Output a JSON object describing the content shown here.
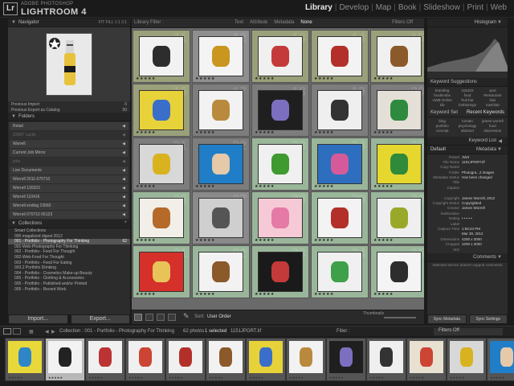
{
  "app": {
    "brand_small": "ADOBE PHOTOSHOP",
    "brand_big": "LIGHTROOM 4",
    "logo": "Lr",
    "modules": [
      "Library",
      "Develop",
      "Map",
      "Book",
      "Slideshow",
      "Print",
      "Web"
    ],
    "active_module": "Library"
  },
  "left": {
    "navigator": {
      "title": "Navigator",
      "zoom": [
        "FIT",
        "FILL",
        "1:1",
        "3:1"
      ]
    },
    "previous": [
      {
        "label": "Previous Import",
        "count": "0"
      },
      {
        "label": "Previous Export as Catalog",
        "count": "50"
      }
    ],
    "folders_title": "Folders",
    "folders": [
      {
        "label": "Retail",
        "count": "",
        "dim": false
      },
      {
        "label": "Z3957 Lacity",
        "count": "",
        "dim": true
      },
      {
        "label": "Warrell",
        "count": "",
        "dim": false
      },
      {
        "label": "Current Job Mirror",
        "count": "",
        "dim": false
      },
      {
        "label": "jobs",
        "count": "",
        "dim": true
      },
      {
        "label": "Live Documents",
        "count": "",
        "dim": false
      },
      {
        "label": "Worrell 2011-070710",
        "count": "",
        "dim": false
      },
      {
        "label": "Worrell 130323",
        "count": "",
        "dim": false
      },
      {
        "label": "Worrell 110416",
        "count": "",
        "dim": false
      },
      {
        "label": "Worrell ending 23560",
        "count": "",
        "dim": false
      },
      {
        "label": "Worrell 070710 05123",
        "count": "",
        "dim": false
      }
    ],
    "collections_title": "Collections",
    "collections": [
      {
        "label": "Smart Collections",
        "count": "",
        "sel": false
      },
      {
        "label": "000 magalized digest 2012",
        "count": "",
        "sel": false
      },
      {
        "label": "001 - Portfolio - Photography For Thinking",
        "count": "62",
        "sel": true
      },
      {
        "label": "001-Web-Photography For Thinking",
        "count": "",
        "sel": false
      },
      {
        "label": "002 - Portfolio - Food For Thought",
        "count": "",
        "sel": false
      },
      {
        "label": "002-Web-Food For Thought",
        "count": "",
        "sel": false
      },
      {
        "label": "003 - Portfolio - Food For Eating",
        "count": "",
        "sel": false
      },
      {
        "label": "003.2 Portfolio Drinking",
        "count": "",
        "sel": false
      },
      {
        "label": "004 - Portfolio - Cosmetics Make-up Beauty",
        "count": "",
        "sel": false
      },
      {
        "label": "005 - Portfolio - Clothing & Accessories",
        "count": "",
        "sel": false
      },
      {
        "label": "005 - Portfolio - Published and/or Printed",
        "count": "",
        "sel": false
      },
      {
        "label": "005 - Portfolio - Recent Work",
        "count": "",
        "sel": false
      }
    ],
    "import_label": "Import...",
    "export_label": "Export..."
  },
  "filter": {
    "title": "Library Filter :",
    "options": [
      "Text",
      "Attribute",
      "Metadata",
      "None"
    ],
    "active": "None",
    "preset": "Filters Off"
  },
  "grid_cells": [
    {
      "n": "11",
      "bg": "#9aa07a",
      "thumb": "#f2f2f2",
      "accent": "#2d2d2d"
    },
    {
      "n": "12",
      "bg": "#8f8f8f",
      "thumb": "#f4f4f4",
      "accent": "#c9961f"
    },
    {
      "n": "13",
      "bg": "#9aa07a",
      "thumb": "#f0f0f0",
      "accent": "#c43a3a"
    },
    {
      "n": "14",
      "bg": "#9aa07a",
      "thumb": "#f3f3f3",
      "accent": "#b3302a"
    },
    {
      "n": "15",
      "bg": "#9aa07a",
      "thumb": "#f0f0f0",
      "accent": "#8c5a2a"
    },
    {
      "n": "16",
      "bg": "#9aa07a",
      "thumb": "#e8d23a",
      "accent": "#3a6fc9"
    },
    {
      "n": "17",
      "bg": "#7d7d7d",
      "thumb": "#f2f2f2",
      "accent": "#b98a3e"
    },
    {
      "n": "18",
      "bg": "#7d7d7d",
      "thumb": "#1f1f1f",
      "accent": "#7d6fbf"
    },
    {
      "n": "19",
      "bg": "#7d7d7d",
      "thumb": "#efefef",
      "accent": "#333"
    },
    {
      "n": "20",
      "bg": "#7d7d7d",
      "thumb": "#e4e0d8",
      "accent": "#2e8a3e"
    },
    {
      "n": "21",
      "bg": "#7d7d7d",
      "thumb": "#d8d8d8",
      "accent": "#d8b31f"
    },
    {
      "n": "22",
      "bg": "#7d7d7d",
      "thumb": "#1f7ec7",
      "accent": "#e5c9a8"
    },
    {
      "n": "23",
      "bg": "#9ab69a",
      "thumb": "#f0f0f0",
      "accent": "#3f9a2f"
    },
    {
      "n": "24",
      "bg": "#9ab69a",
      "thumb": "#2d6fbe",
      "accent": "#d55a9a"
    },
    {
      "n": "25",
      "bg": "#9ab69a",
      "thumb": "#e6d72e",
      "accent": "#2f8a3a"
    },
    {
      "n": "26",
      "bg": "#9ab69a",
      "thumb": "#f2efe8",
      "accent": "#b56a2a"
    },
    {
      "n": "27",
      "bg": "#8a8a8a",
      "thumb": "#cfcfcf",
      "accent": "#555"
    },
    {
      "n": "28",
      "bg": "#9ab69a",
      "thumb": "#f6c9d6",
      "accent": "#e47aa5"
    },
    {
      "n": "29",
      "bg": "#9ab69a",
      "thumb": "#f3f3f3",
      "accent": "#b3302a"
    },
    {
      "n": "30",
      "bg": "#9ab69a",
      "thumb": "#efefef",
      "accent": "#9aa82a"
    },
    {
      "n": "31",
      "bg": "#9ab69a",
      "thumb": "#d6302a",
      "accent": "#e8c35a"
    },
    {
      "n": "32",
      "bg": "#9ab69a",
      "thumb": "#f2f2f2",
      "accent": "#8a5a2a"
    },
    {
      "n": "33",
      "bg": "#9ab69a",
      "thumb": "#1a1a1a",
      "accent": "#c43a3a"
    },
    {
      "n": "34",
      "bg": "#9ab69a",
      "thumb": "#f0f0f0",
      "accent": "#3fa04a"
    },
    {
      "n": "35",
      "bg": "#9ab69a",
      "thumb": "#f4f4f4",
      "accent": "#2d2d2d"
    }
  ],
  "toolbar": {
    "sort_label": "Sort:",
    "sort_value": "User Order",
    "thumbs_label": "Thumbnails"
  },
  "right": {
    "histogram_title": "Histogram",
    "kw_suggest_title": "Keyword Suggestions",
    "kw_suggest": [
      "branding",
      "1184Z2",
      "spot",
      "foodsnobs",
      "food",
      "Restaurant",
      "AWB Online",
      "fruit bar",
      "kiwi",
      "kib",
      "forthdesign",
      "mashlab"
    ],
    "kw_set_title": "Keyword Set",
    "kw_set_value": "Recent Keywords",
    "kw_set": [
      "blog",
      "tomato",
      "james worrell",
      "portfolio",
      "psychology",
      "food",
      "concept",
      "abstract",
      "depression"
    ],
    "kw_list_title": "Keyword List",
    "metadata_title": "Metadata",
    "metadata_preset": "Default",
    "meta": [
      {
        "k": "Preset",
        "v": "JWII"
      },
      {
        "k": "File Name",
        "v": "1151JPORT.tif"
      },
      {
        "k": "Copy Name",
        "v": ""
      },
      {
        "k": "Folder",
        "v": "Photogra...2 images"
      },
      {
        "k": "Metadata Status",
        "v": "Has been changed"
      },
      {
        "k": "Title",
        "v": ""
      },
      {
        "k": "Caption",
        "v": ""
      },
      {
        "k": "",
        "v": ""
      },
      {
        "k": "Copyright",
        "v": "James Worrell, 2012"
      },
      {
        "k": "Copyright Status",
        "v": "Copyrighted"
      },
      {
        "k": "Creator",
        "v": "James Worrell"
      },
      {
        "k": "Sublocation",
        "v": ""
      },
      {
        "k": "Rating",
        "v": "• • • • •"
      },
      {
        "k": "Label",
        "v": ""
      },
      {
        "k": "Capture Time",
        "v": "1:58:24 PM"
      },
      {
        "k": "",
        "v": "Mar 30, 2012"
      },
      {
        "k": "Dimensions",
        "v": "4200 x 3000"
      },
      {
        "k": "Cropped",
        "v": "4200 x 3000"
      },
      {
        "k": "ISO",
        "v": ""
      }
    ],
    "comments_title": "Comments",
    "comments_note": "Selected service doesn't support comments",
    "sync_meta": "Sync Metadata",
    "sync_settings": "Sync Settings"
  },
  "filmstrip": {
    "collection": "Collection : 001 - Portfolio - Photography For Thinking",
    "photo_count": "62 photos",
    "selected": "1 selected",
    "filename": "1151JPORT.tif",
    "filter_label": "Filter :",
    "filter_value": "Filters Off",
    "colors": [
      [
        "#e9d83a",
        "#2e86c9"
      ],
      [
        "#f2f2f2",
        "#222"
      ],
      [
        "#f0f0f0",
        "#b33"
      ],
      [
        "#f0f0f0",
        "#c43"
      ],
      [
        "#f0f0f0",
        "#b3302a"
      ],
      [
        "#f2f2f2",
        "#8c5a2a"
      ],
      [
        "#e8d23a",
        "#3a6fc9"
      ],
      [
        "#f2f2f2",
        "#b98a3e"
      ],
      [
        "#1f1f1f",
        "#7d6fbf"
      ],
      [
        "#efefef",
        "#333"
      ],
      [
        "#e8e0d0",
        "#c43"
      ],
      [
        "#d8d8d8",
        "#d8b31f"
      ],
      [
        "#1f7ec7",
        "#e5c9a8"
      ]
    ]
  }
}
